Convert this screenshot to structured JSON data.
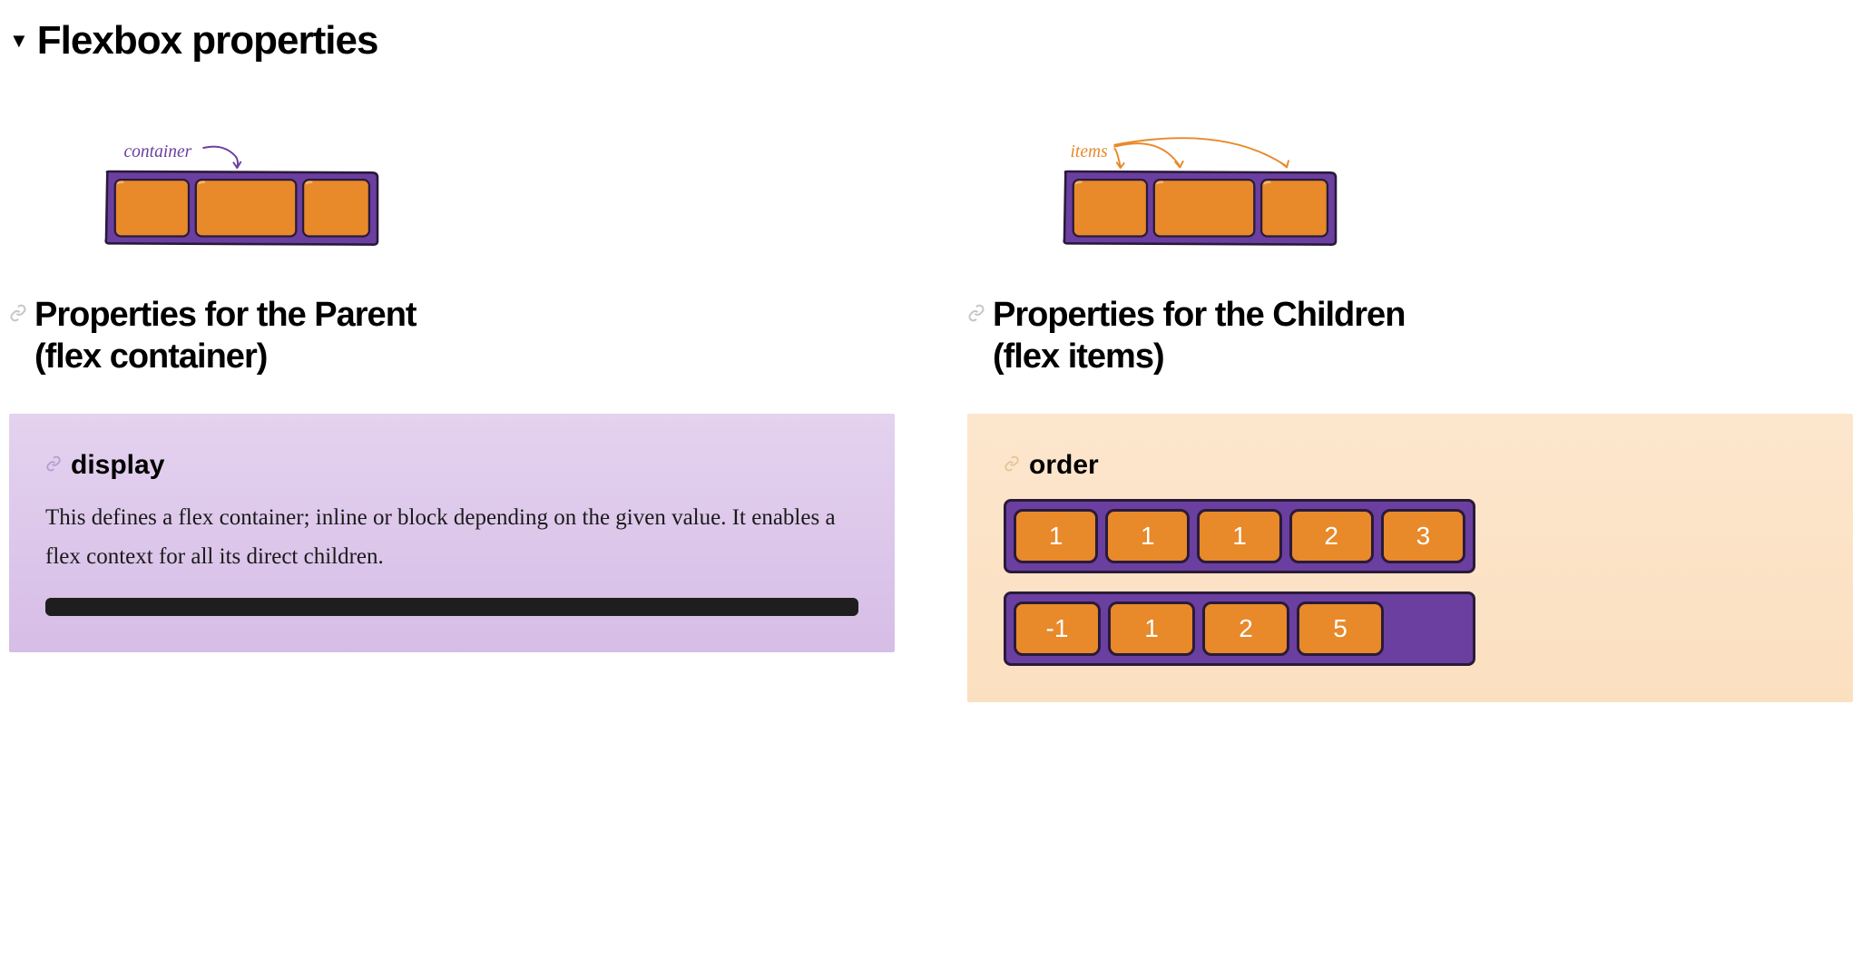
{
  "heading": "Flexbox properties",
  "container_column": {
    "diagram_label": "container",
    "subheading_line1": "Properties for the Parent",
    "subheading_line2": "(flex container)",
    "property": {
      "name": "display",
      "description": "This defines a flex container; inline or block depending on the given value. It enables a flex context for all its direct children."
    }
  },
  "items_column": {
    "diagram_label": "items",
    "subheading_line1": "Properties for the Children",
    "subheading_line2": "(flex items)",
    "property": {
      "name": "order",
      "order_row1": [
        "1",
        "1",
        "1",
        "2",
        "3"
      ],
      "order_row2": [
        "-1",
        "1",
        "2",
        "5"
      ]
    }
  },
  "colors": {
    "purple": "#6b3fa0",
    "orange": "#e8892a",
    "panel_container": "#e4d2ef",
    "panel_items": "#fce6cd"
  }
}
